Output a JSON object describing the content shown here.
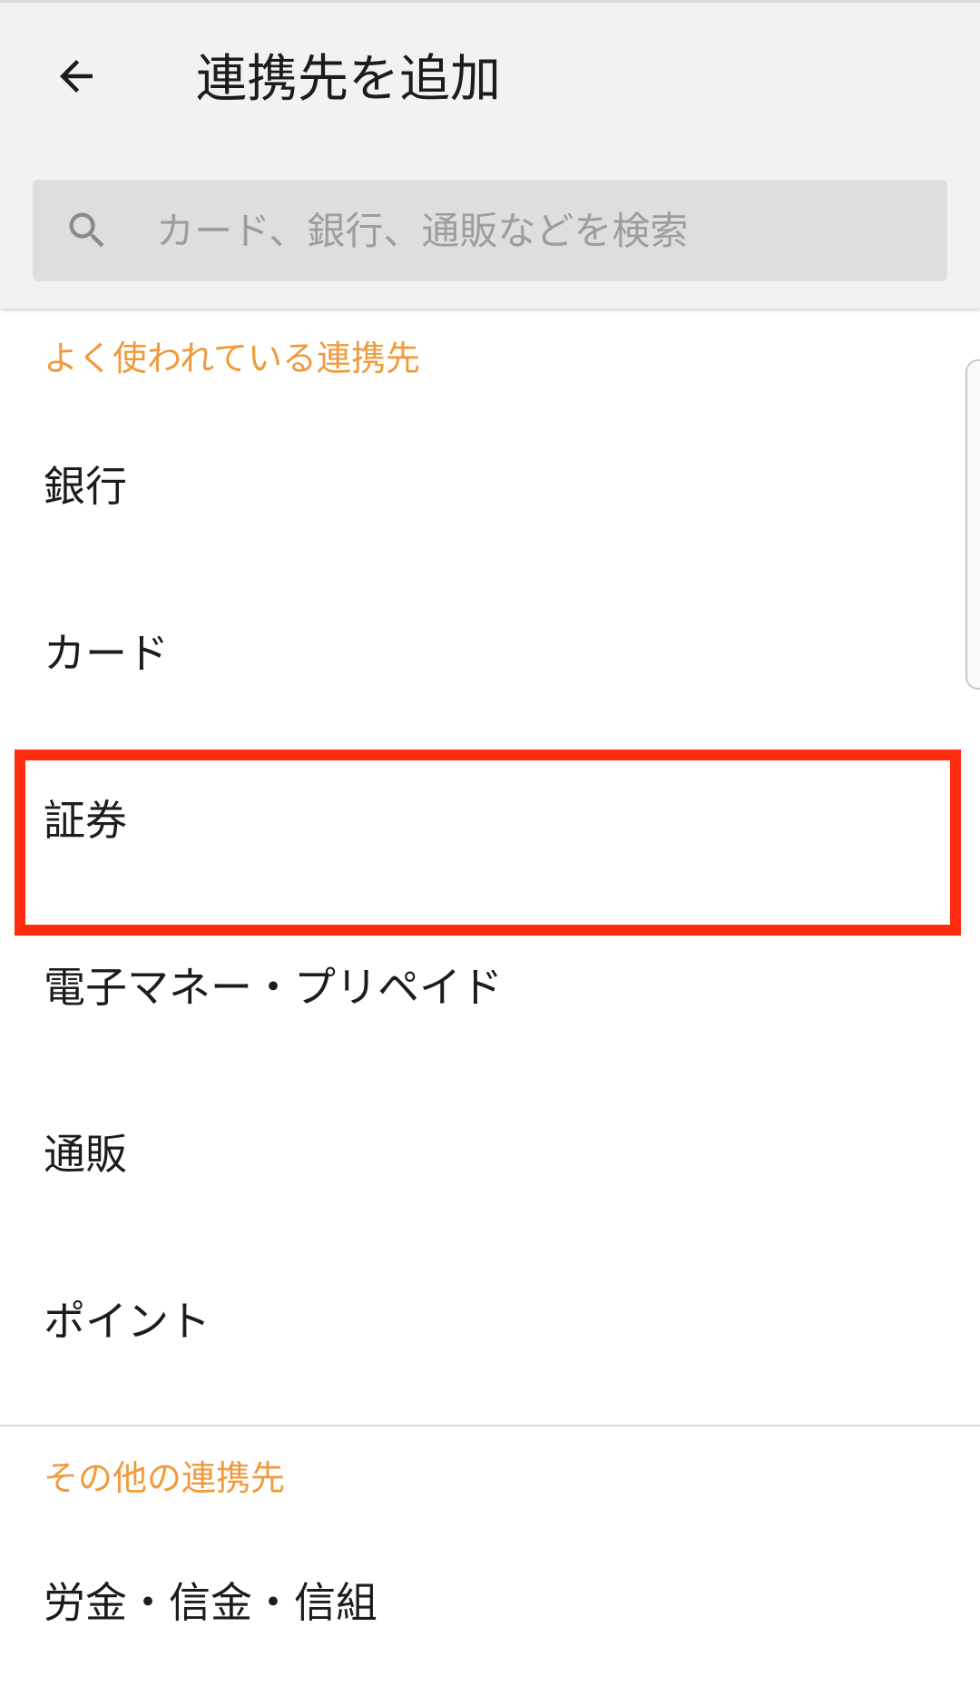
{
  "header": {
    "back_icon": "arrow-left-icon",
    "title": "連携先を追加"
  },
  "search": {
    "icon": "search-icon",
    "placeholder": "カード、銀行、通販などを検索",
    "value": ""
  },
  "sections": {
    "popular": {
      "title": "よく使われている連携先",
      "items": [
        {
          "label": "銀行"
        },
        {
          "label": "カード"
        },
        {
          "label": "証券",
          "highlighted": true
        },
        {
          "label": "電子マネー・プリペイド"
        },
        {
          "label": "通販"
        },
        {
          "label": "ポイント"
        }
      ]
    },
    "other": {
      "title": "その他の連携先",
      "items": [
        {
          "label": "労金・信金・信組"
        }
      ]
    }
  },
  "colors": {
    "section_header": "#f09a3b",
    "highlight_border": "#ff2d0e",
    "app_bar_bg": "#f2f2f2",
    "search_bg": "#dedede"
  }
}
